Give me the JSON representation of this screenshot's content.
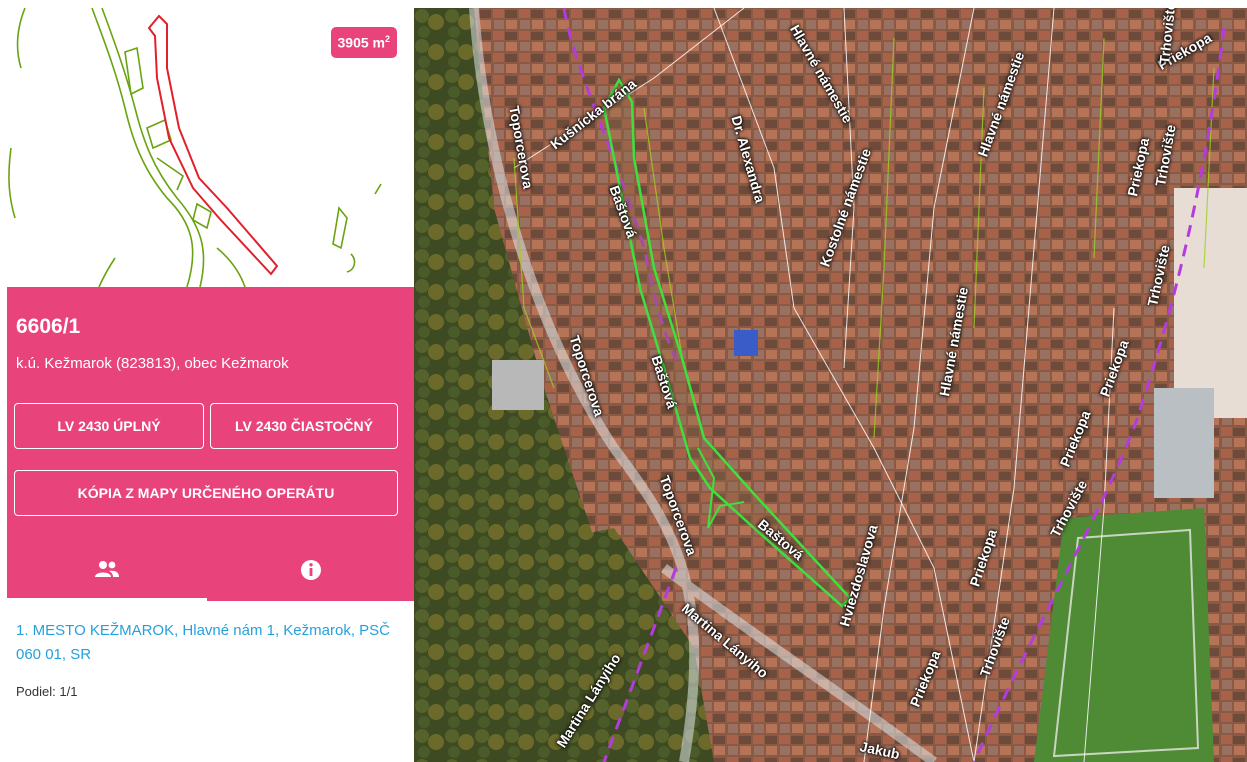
{
  "parcel": {
    "number": "6606/1",
    "area_value": "3905 m",
    "area_exp": "2",
    "cadastral_text": "k.ú. Kežmarok (823813), obec Kežmarok"
  },
  "actions": {
    "lv_full": "LV 2430 ÚPLNÝ",
    "lv_partial": "LV 2430 ČIASTOČNÝ",
    "map_copy": "KÓPIA Z MAPY URČENÉHO OPERÁTU"
  },
  "tabs": [
    {
      "icon": "people-icon",
      "active": true
    },
    {
      "icon": "info-icon",
      "active": false
    }
  ],
  "owners": [
    {
      "text": "1. MESTO KEŽMAROK, Hlavné nám 1, Kežmarok, PSČ 060 01, SR",
      "share": "Podiel: 1/1"
    }
  ],
  "map": {
    "street_labels": [
      "Toporcerova",
      "Toporcerova",
      "Toporcerova",
      "Kušnícka brána",
      "Dr. Alexandra",
      "Kostolné námestie",
      "Hlavné námestie",
      "Hlavné námestie",
      "Hlavné námestie",
      "Baštová",
      "Baštová",
      "Baštová",
      "Priekopa",
      "Priekopa",
      "Priekopa",
      "Priekopa",
      "Priekopa",
      "Priekopa",
      "Trhovište",
      "Trhovište",
      "Trhovište",
      "Trhovište",
      "Trhovište",
      "Martina Lányiho",
      "Martina Lányiho",
      "Hviezdoslavova",
      "Jakub"
    ],
    "colors": {
      "parcel_highlight": "#3ee03e",
      "border_dashed": "#b43cdc",
      "accent": "#e8447b"
    }
  }
}
